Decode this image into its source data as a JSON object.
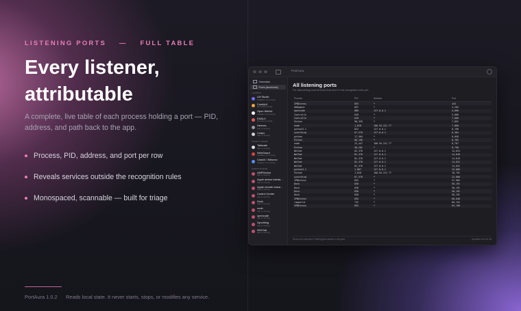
{
  "hero": {
    "eyebrow_left": "LISTENING PORTS",
    "eyebrow_dash": "—",
    "eyebrow_right": "FULL TABLE",
    "title_line1": "Every listener,",
    "title_line2": "attributable",
    "description": "A complete, live table of each process holding a port — PID, address, and path back to the app.",
    "bullets": [
      "Process, PID, address, and port per row",
      "Reveals services outside the recognition rules",
      "Monospaced, scannable — built for triage"
    ]
  },
  "footer": {
    "app": "PortAura 1.0.2",
    "sep": "·",
    "note": "Reads local state. It never starts, stops, or modifies any service."
  },
  "window": {
    "title": "PortAura",
    "nav": [
      {
        "label": "Overview"
      },
      {
        "label": "Ports (technical)"
      }
    ],
    "section_localhost": "Localhost",
    "localhost_items": [
      {
        "name": "LM Studio",
        "status": "Installed, not running",
        "color": "#6c6aff"
      },
      {
        "name": "ComfyUI",
        "status": "Running normally",
        "color": "#f0a63a"
      },
      {
        "name": "Open WebUI",
        "status": "Installed, not running",
        "color": "#ffffff"
      },
      {
        "name": "ENSLX",
        "status": "Running normally",
        "color": "#e05a5a"
      },
      {
        "name": "Hermes",
        "status": "App is running",
        "color": "#9a98a3"
      },
      {
        "name": "Codex",
        "status": "App is running",
        "color": "#cfcfd6"
      }
    ],
    "section_private": "Private & remote",
    "private_items": [
      {
        "name": "Tailscale",
        "status": "App is running",
        "color": "#dcdce2"
      },
      {
        "name": "WireGuard",
        "status": "Installed, not running",
        "color": "#d9433f"
      },
      {
        "name": "ClashX / Mihomo",
        "status": "Installed, not running",
        "color": "#5a8cff"
      }
    ],
    "section_system": "System services",
    "system_items": [
      {
        "name": "AMPDevice",
        "status": "App is running",
        "color": "#c24f6a"
      },
      {
        "name": "Apple device interfa…",
        "status": "App is running",
        "color": "#c24f6a"
      },
      {
        "name": "Apple remote mana…",
        "status": "App is running",
        "color": "#c24f6a"
      },
      {
        "name": "Control Center",
        "status": "App is running",
        "color": "#c24f6a"
      },
      {
        "name": "Dock",
        "status": "App is running",
        "color": "#c24f6a"
      },
      {
        "name": "node",
        "status": "App is running",
        "color": "#c24f6a"
      },
      {
        "name": "opencode",
        "status": "App is running",
        "color": "#c24f6a"
      },
      {
        "name": "Syncthing",
        "status": "App is running",
        "color": "#c24f6a"
      },
      {
        "name": "WeChat",
        "status": "App is running",
        "color": "#c24f6a"
      }
    ],
    "main_title": "All listening ports",
    "main_subtitle": "For discovering local services that aren't in the recognition rules yet.",
    "columns": [
      "Process",
      "PID",
      "Address",
      "Port"
    ],
    "rows": [
      [
        "IPNExtens",
        "855",
        "*",
        "443"
      ],
      [
        "ARDAgent",
        "897",
        "*",
        "3,283"
      ],
      [
        "opencode",
        "889",
        "127.0.0.1",
        "4,096"
      ],
      [
        "ControlCe",
        "649",
        "*",
        "5,000"
      ],
      [
        "ControlCe",
        "649",
        "*",
        "7,000"
      ],
      [
        "Python",
        "98,339",
        "*",
        "7,892"
      ],
      [
        "node",
        "1,818",
        "100.94.221.77",
        "7,860"
      ],
      [
        "python3.1",
        "822",
        "127.0.0.1",
        "8,198"
      ],
      [
        "syncthing",
        "67,570",
        "127.0.0.1",
        "8,384"
      ],
      [
        "python",
        "17,564",
        "*",
        "8,658"
      ],
      [
        "Python",
        "68,196",
        "*",
        "8,765"
      ],
      [
        "node",
        "23,447",
        "100.94.221.77",
        "8,787"
      ],
      [
        "Python",
        "58,201",
        "*",
        "8,790"
      ],
      [
        "WeChat",
        "82,370",
        "127.0.0.1",
        "14,013"
      ],
      [
        "WeChat",
        "82,370",
        "127.0.0.1",
        "14,016"
      ],
      [
        "WeChat",
        "82,370",
        "127.0.0.1",
        "14,019"
      ],
      [
        "WeChat",
        "82,370",
        "127.0.0.1",
        "14,022"
      ],
      [
        "WeChat",
        "82,370",
        "127.0.0.1",
        "14,022"
      ],
      [
        "python3.1",
        "1,867",
        "127.0.0.1",
        "15,000"
      ],
      [
        "Python",
        "1,818",
        "100.94.221.77",
        "18,791"
      ],
      [
        "syncthing",
        "67,570",
        "*",
        "22,000"
      ],
      [
        "IPNExtens",
        "855",
        "*",
        "37,965"
      ],
      [
        "Dock",
        "836",
        "*",
        "50,191"
      ],
      [
        "Dock",
        "836",
        "*",
        "50,191"
      ],
      [
        "Dock",
        "836",
        "*",
        "50,191"
      ],
      [
        "Dock",
        "836",
        "*",
        "50,191"
      ],
      [
        "IPNExtens",
        "855",
        "*",
        "60,040"
      ],
      [
        "rapportd",
        "732",
        "*",
        "60,152"
      ],
      [
        "IPNExtens",
        "855",
        "*",
        "63,196"
      ]
    ],
    "footer_left": "Read-only inspection. Nothing gets started or stopped.",
    "footer_right": "Updated at 02:51:38"
  }
}
